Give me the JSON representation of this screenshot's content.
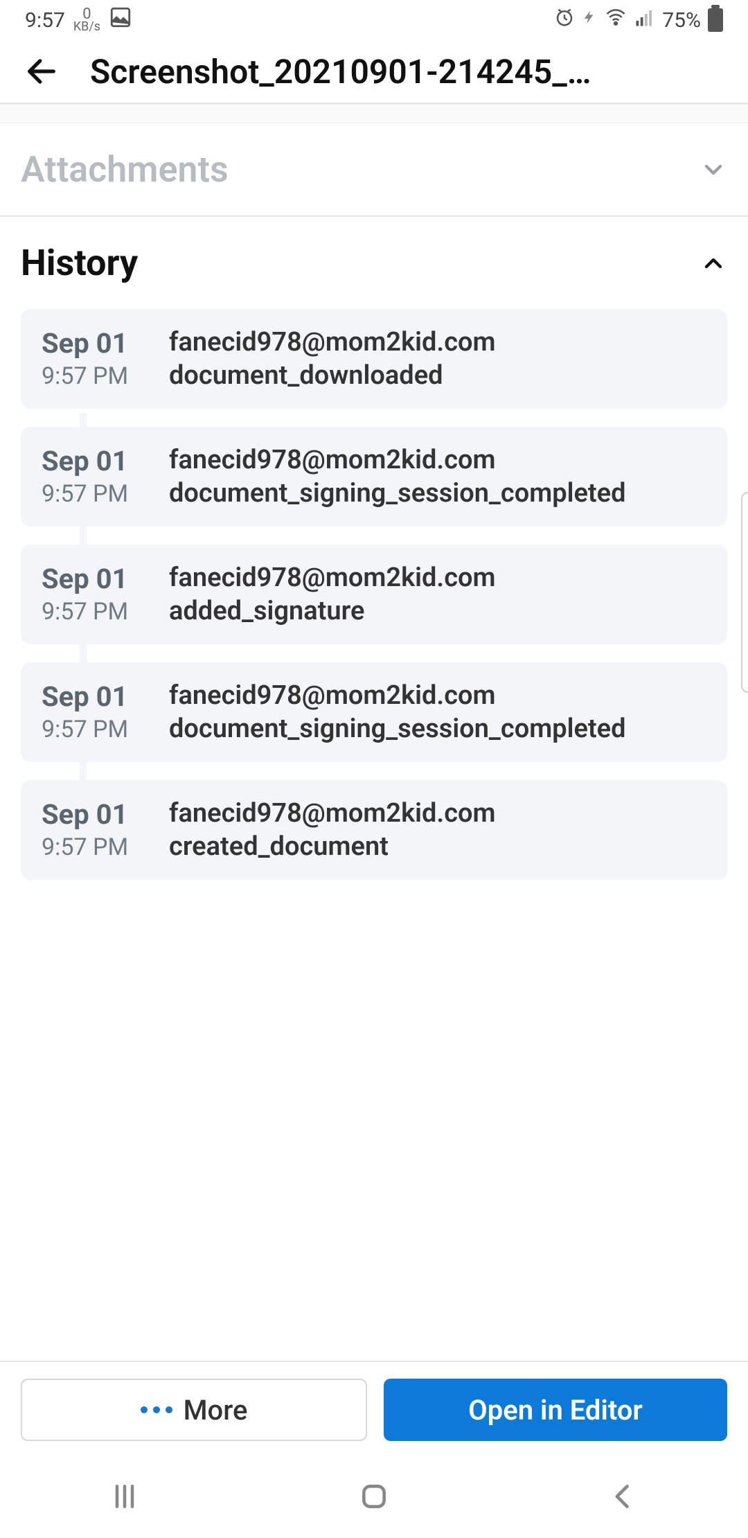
{
  "status": {
    "time": "9:57",
    "kbs_top": "0",
    "kbs_bottom": "KB/s",
    "battery": "75%"
  },
  "header": {
    "title": "Screenshot_20210901-214245_…"
  },
  "sections": {
    "attachments_label": "Attachments",
    "history_label": "History"
  },
  "history": [
    {
      "date": "Sep 01",
      "time": "9:57 PM",
      "email": "fanecid978@mom2kid.com",
      "action": "document_downloaded"
    },
    {
      "date": "Sep 01",
      "time": "9:57 PM",
      "email": "fanecid978@mom2kid.com",
      "action": "document_signing_session_completed"
    },
    {
      "date": "Sep 01",
      "time": "9:57 PM",
      "email": "fanecid978@mom2kid.com",
      "action": "added_signature"
    },
    {
      "date": "Sep 01",
      "time": "9:57 PM",
      "email": "fanecid978@mom2kid.com",
      "action": "document_signing_session_completed"
    },
    {
      "date": "Sep 01",
      "time": "9:57 PM",
      "email": "fanecid978@mom2kid.com",
      "action": "created_document"
    }
  ],
  "bottom": {
    "more_label": "More",
    "open_label": "Open in Editor"
  }
}
